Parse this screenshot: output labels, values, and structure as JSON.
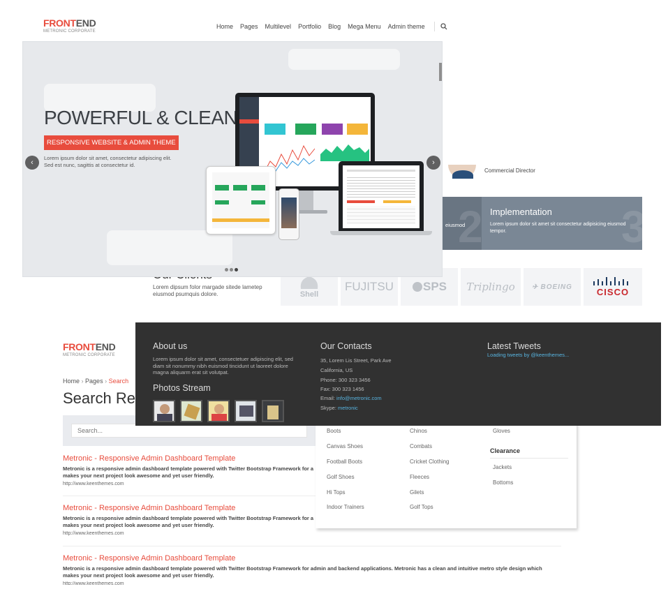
{
  "header": {
    "logo_a": "FRONT",
    "logo_b": "END",
    "logo_sub": "METRONIC CORPORATE",
    "nav": [
      "Home",
      "Pages",
      "Multilevel",
      "Portfolio",
      "Blog",
      "Mega Menu",
      "Admin theme"
    ]
  },
  "hero": {
    "title": "POWERFUL & CLEAN",
    "badge": "RESPONSIVE WEBSITE & ADMIN THEME",
    "text_line1": "Lorem ipsum dolor sit amet, consectetur adipiscing elit.",
    "text_line2": "Sed est nunc, sagittis at consectetur id."
  },
  "testimonial": {
    "role": "Commercial Director"
  },
  "steps": {
    "prev_fragment": "eiusmod",
    "title": "Implementation",
    "text_line1": "Lorem ipsum dolor sit amet sit consectetur adipisicing eiusmod",
    "text_line2": "tempor."
  },
  "clients": {
    "title": "Our Clients",
    "text_line1": "Lorem dipsum folor margade sitede lametep",
    "text_line2": "eiusmod psumquis dolore.",
    "logos": [
      "Shell",
      "FUJITSU",
      "SPS",
      "Triplingo",
      "BOEING",
      "CISCO"
    ]
  },
  "page2": {
    "logo_a": "FRONT",
    "logo_b": "END",
    "logo_sub": "METRONIC CORPORATE",
    "breadcrumb": [
      "Home",
      "Pages",
      "Search"
    ],
    "title": "Search Re",
    "search_placeholder": "Search...",
    "results": [
      {
        "title": "Metronic - Responsive Admin Dashboard Template",
        "desc_line1": "Metronic is a responsive admin dashboard template powered with Twitter Bootstrap Framework for a",
        "desc_line2": "makes your next project look awesome and yet user friendly.",
        "url": "http://www.keenthemes.com"
      },
      {
        "title": "Metronic - Responsive Admin Dashboard Template",
        "desc_line1": "Metronic is a responsive admin dashboard template powered with Twitter Bootstrap Framework for a",
        "desc_line2": "makes your next project look awesome and yet user friendly.",
        "url": "http://www.keenthemes.com"
      },
      {
        "title": "Metronic - Responsive Admin Dashboard Template",
        "desc_line1": "Metronic is a responsive admin dashboard template powered with Twitter Bootstrap Framework for admin and backend applications. Metronic has a clean and intuitive metro style design which",
        "desc_line2": "makes your next project look awesome and yet user friendly.",
        "url": "http://www.keenthemes.com"
      }
    ]
  },
  "mega_menu": {
    "col1": [
      "Boots",
      "Canvas Shoes",
      "Football Boots",
      "Golf Shoes",
      "Hi Tops",
      "Indoor Trainers"
    ],
    "col2": [
      "Chinos",
      "Combats",
      "Cricket Clothing",
      "Fleeces",
      "Gilets",
      "Golf Tops"
    ],
    "col3_top": "Gloves",
    "col3_heading": "Clearance",
    "col3": [
      "Jackets",
      "Bottoms"
    ]
  },
  "footer": {
    "about_title": "About us",
    "about_line1": "Lorem ipsum dolor sit amet, consectetuer adipiscing elit, sed",
    "about_line2": "diam sit nonummy nibh euismod tincidunt ut laoreet dolore",
    "about_line3": "magna aliquarm erat sit volutpat.",
    "photos_title": "Photos Stream",
    "contacts_title": "Our Contacts",
    "address1": "35, Lorem Lis Street, Park Ave",
    "address2": "California, US",
    "phone": "Phone: 300 323 3456",
    "fax": "Fax: 300 323 1456",
    "email_label": "Email:",
    "email": "info@metronic.com",
    "skype_label": "Skype:",
    "skype": "metronic",
    "tweets_title": "Latest Tweets",
    "tweets_loading": "Loading tweets by @keenthemes..."
  },
  "colors": {
    "accent": "#e84c3d",
    "footer_bg": "#313131",
    "link": "#58b4e0",
    "step_bg": "#7a8795"
  }
}
